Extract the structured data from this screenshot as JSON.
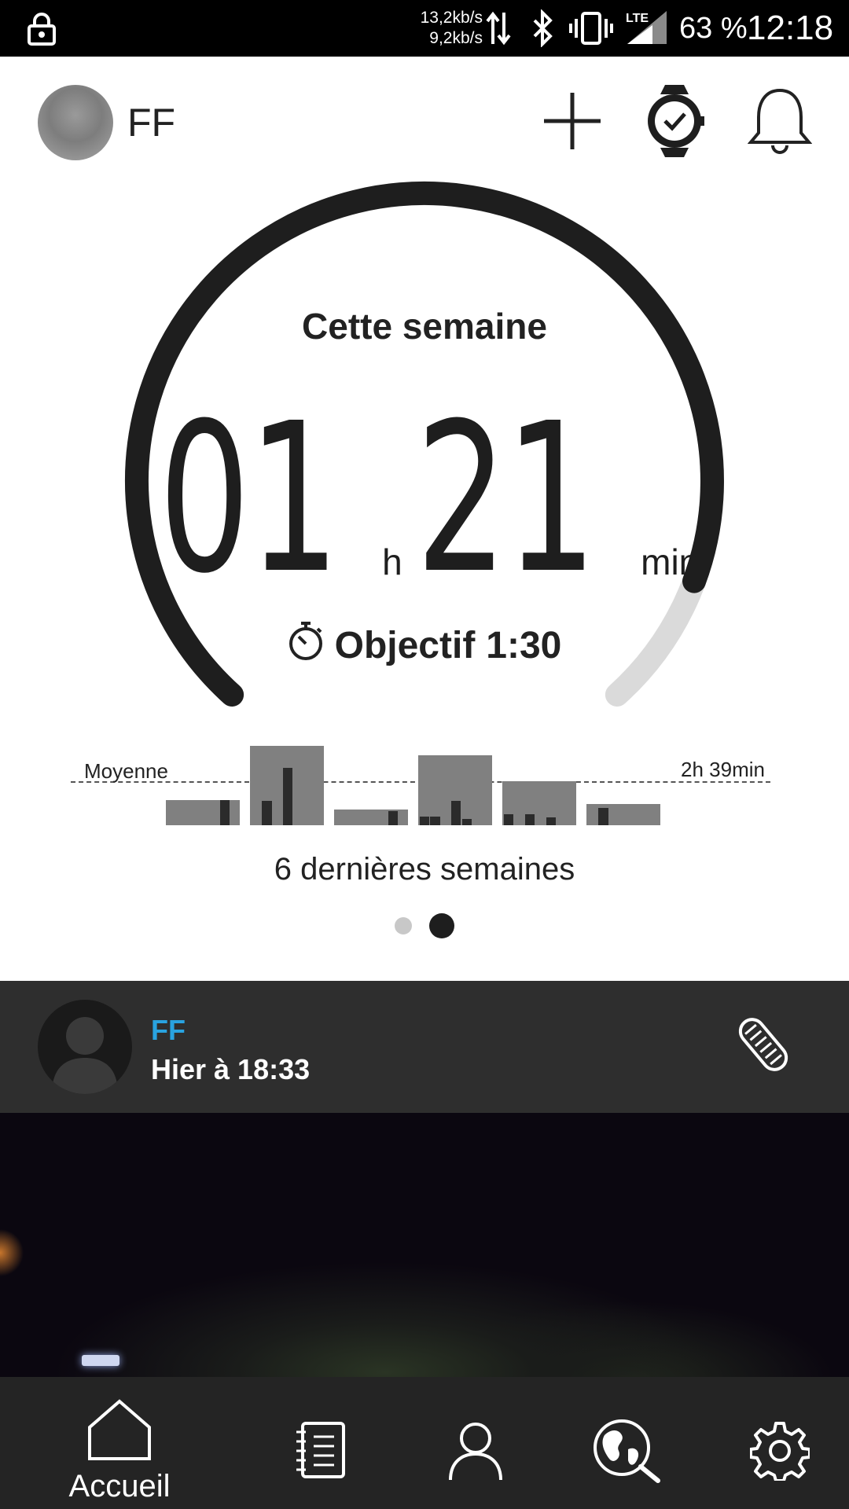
{
  "status_bar": {
    "upload_rate": "13,2kb/s",
    "download_rate": "9,2kb/s",
    "network": "LTE",
    "battery": "63 %",
    "time": "12:18"
  },
  "header": {
    "username": "FF",
    "icons": [
      "add-icon",
      "watch-check-icon",
      "bell-icon"
    ]
  },
  "summary": {
    "title": "Cette semaine",
    "hours": "01",
    "hours_unit": "h",
    "minutes": "21",
    "minutes_unit": "min",
    "goal_label": "Objectif",
    "goal_value": "1:30",
    "progress_fraction": 0.9
  },
  "weekly": {
    "average_label": "Moyenne",
    "average_value": "2h 39min",
    "caption": "6 dernières semaines",
    "page_count": 2,
    "active_page": 1
  },
  "chart_data": {
    "type": "bar",
    "title": "",
    "categories": [
      "",
      "",
      "",
      "",
      "",
      ""
    ],
    "series": [
      {
        "values": [
          0.32,
          1.0,
          0.2,
          0.88,
          0.55,
          0.27
        ]
      }
    ],
    "daily": [
      [
        0,
        0,
        0,
        0,
        0,
        0.88,
        0
      ],
      [
        0,
        0.86,
        0,
        2.04,
        0,
        0,
        0
      ],
      [
        0,
        0,
        0,
        0,
        0,
        0.5,
        0
      ],
      [
        0.3,
        0.3,
        0,
        0.85,
        0.22,
        0,
        0
      ],
      [
        0.4,
        0,
        0.4,
        0,
        0.28,
        0,
        0
      ],
      [
        0,
        0.62,
        0,
        0,
        0,
        0,
        0
      ]
    ],
    "average_line": 0.55,
    "colors": {
      "week": "#808080",
      "day": "#2b2b2b"
    }
  },
  "feed": {
    "user": "FF",
    "time": "Hier à 18:33",
    "sport_icon": "running-shoe-icon"
  },
  "bottom_nav": {
    "items": [
      {
        "label": "Accueil",
        "icon": "home-icon",
        "active": true
      },
      {
        "label": "",
        "icon": "diary-icon"
      },
      {
        "label": "",
        "icon": "profile-icon"
      },
      {
        "label": "",
        "icon": "explore-globe-icon"
      },
      {
        "label": "",
        "icon": "settings-gear-icon"
      }
    ]
  },
  "colors": {
    "accent_blue": "#29a3e0",
    "gauge_dark": "#1e1e1e",
    "gauge_remaining": "#dadada",
    "feed_bg": "#2e2e2e",
    "nav_bg": "#242424"
  }
}
